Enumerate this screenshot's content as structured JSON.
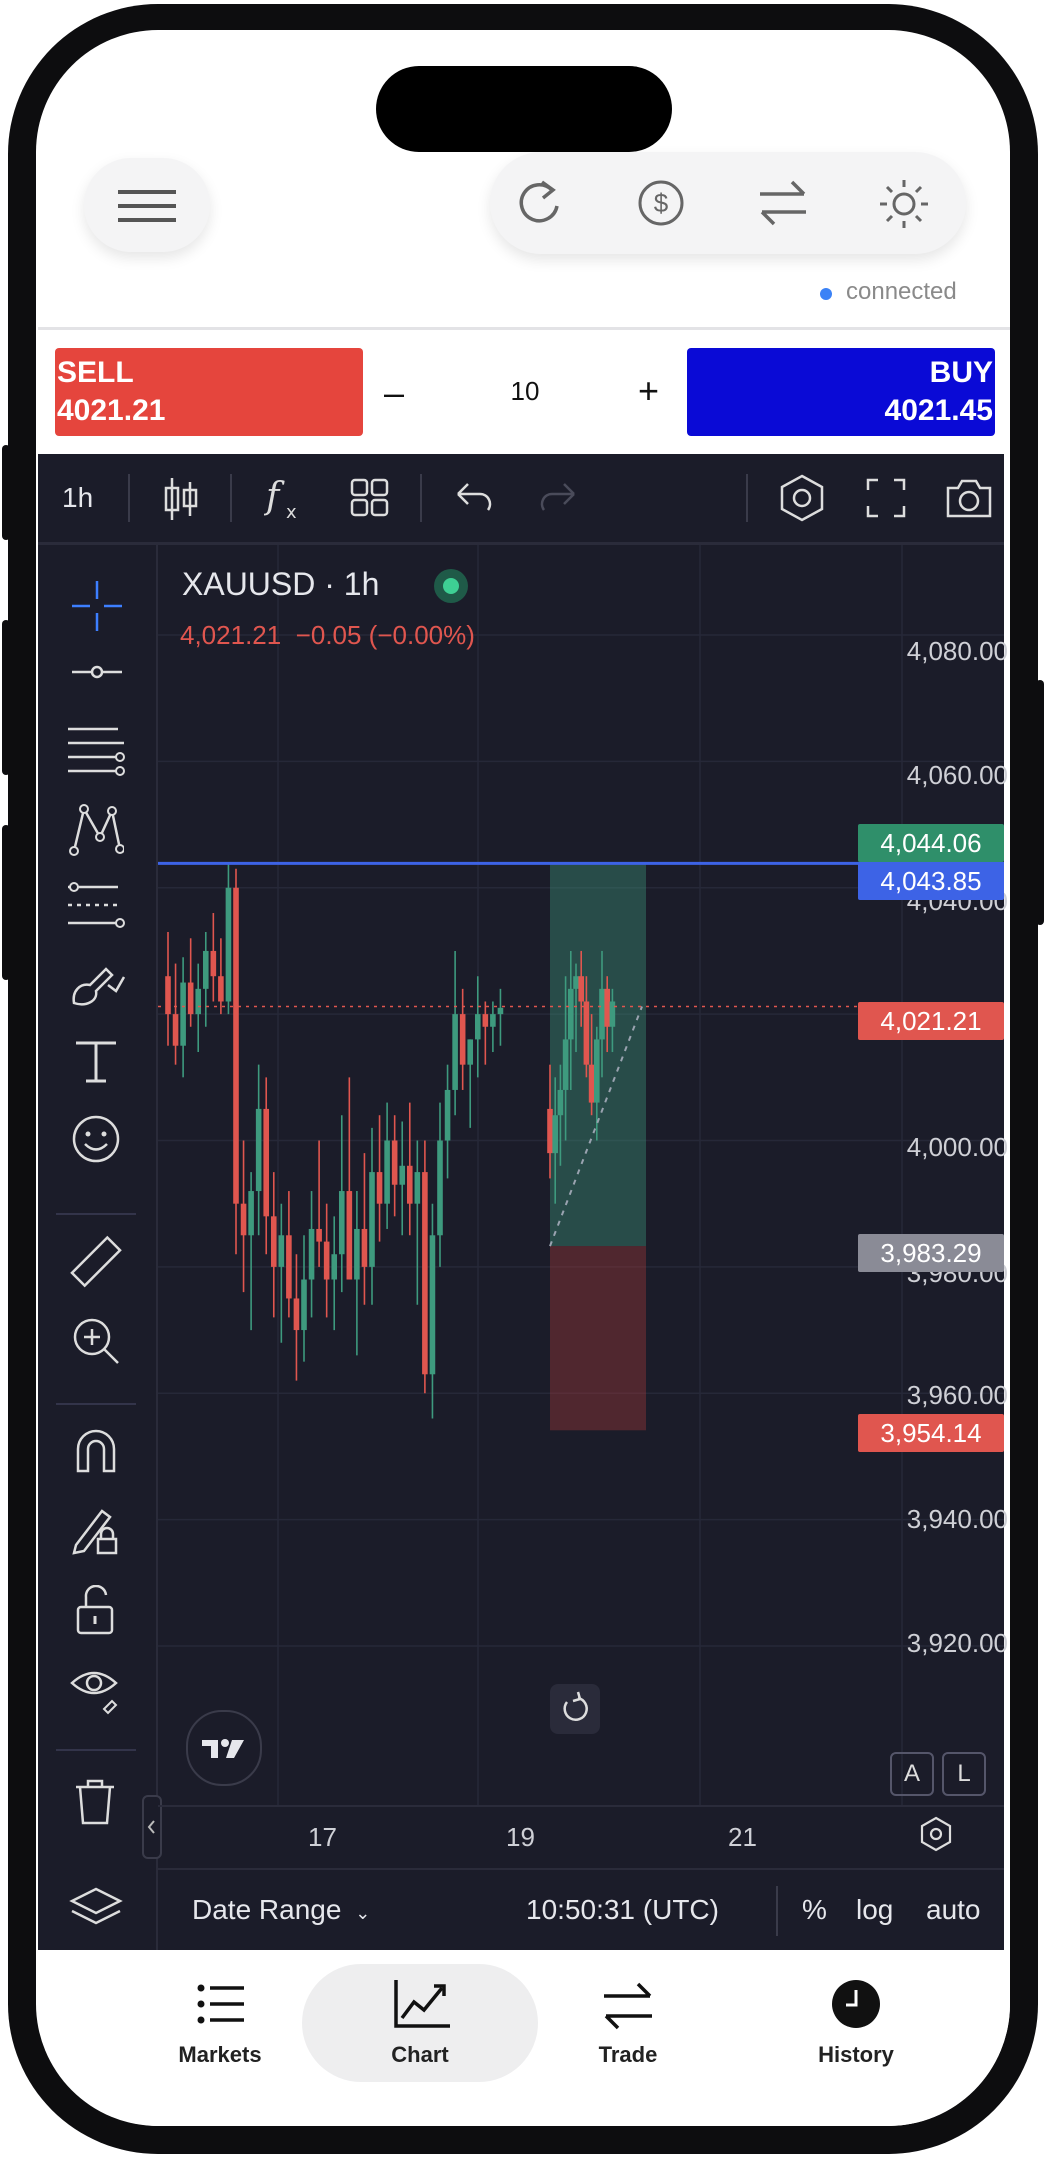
{
  "status": {
    "text": "connected",
    "color": "#3b82f6"
  },
  "trade": {
    "sell_label": "SELL",
    "sell_price": "4021.21",
    "buy_label": "BUY",
    "buy_price": "4021.45",
    "minus": "–",
    "plus": "+",
    "quantity": "10"
  },
  "header_icons": [
    "menu-icon",
    "refresh-icon",
    "dollar-coin-icon",
    "swap-arrows-icon",
    "sun-theme-icon"
  ],
  "toolbar": {
    "interval": "1h",
    "icons": [
      "candles-icon",
      "indicators-fx-icon",
      "layouts-grid-icon",
      "undo-icon",
      "redo-icon",
      "settings-hex-icon",
      "fullscreen-icon",
      "camera-snapshot-icon"
    ]
  },
  "drawing_tools": [
    "crosshair-icon",
    "trend-line-icon",
    "fib-lines-icon",
    "pattern-icon",
    "projection-icon",
    "brush-icon",
    "text-icon",
    "emoji-icon",
    "ruler-icon",
    "zoom-in-icon",
    "magnet-icon",
    "lock-drawing-icon",
    "unlock-icon",
    "eye-icon",
    "trash-icon",
    "layers-icon"
  ],
  "chart": {
    "symbol": "XAUUSD · 1h",
    "quote_price": "4,021.21",
    "quote_change": "−0.05 (−0.00%)",
    "price_axis": [
      "4,080.00",
      "4,060.00",
      "4,040.00",
      "4,000.00",
      "3,980.00",
      "3,960.00",
      "3,940.00",
      "3,920.00"
    ],
    "price_tags": {
      "tp": "4,044.06",
      "line": "4,043.85",
      "current": "4,021.21",
      "entry": "3,983.29",
      "sl": "3,954.14"
    },
    "time_axis": [
      "17",
      "19",
      "21"
    ],
    "scale_buttons": {
      "a": "A",
      "l": "L"
    },
    "colors": {
      "up": "#3e9a7e",
      "down": "#e0564f",
      "line": "#3d63e6",
      "bg": "#1b1c29"
    }
  },
  "bottom_bar": {
    "date_range": "Date Range",
    "time": "10:50:31 (UTC)",
    "pct": "%",
    "log": "log",
    "auto": "auto"
  },
  "nav": {
    "items": [
      {
        "label": "Markets",
        "icon": "list-icon"
      },
      {
        "label": "Chart",
        "icon": "line-chart-icon",
        "active": true
      },
      {
        "label": "Trade",
        "icon": "swap-arrows-icon"
      },
      {
        "label": "History",
        "icon": "clock-icon"
      }
    ]
  },
  "chart_data": {
    "type": "candlestick",
    "title": "XAUUSD · 1h",
    "x_ticks": [
      "17",
      "19",
      "21"
    ],
    "y_ticks": [
      3920,
      3940,
      3960,
      3980,
      4000,
      4040,
      4060,
      4080
    ],
    "ylim": [
      3910,
      4090
    ],
    "horizontal_line": 4043.85,
    "current_price": 4021.21,
    "position": {
      "take_profit": 4044.06,
      "entry": 3983.29,
      "stop_loss": 3954.14
    },
    "candles": [
      [
        4026,
        4033,
        4015,
        4020
      ],
      [
        4020,
        4028,
        4012,
        4015
      ],
      [
        4015,
        4029,
        4010,
        4025
      ],
      [
        4025,
        4032,
        4018,
        4020
      ],
      [
        4020,
        4028,
        4014,
        4024
      ],
      [
        4024,
        4033,
        4018,
        4030
      ],
      [
        4030,
        4036,
        4022,
        4026
      ],
      [
        4026,
        4032,
        4020,
        4022
      ],
      [
        4022,
        4044,
        4020,
        4040
      ],
      [
        4040,
        4043,
        3982,
        3990
      ],
      [
        3990,
        4000,
        3976,
        3985
      ],
      [
        3985,
        3995,
        3970,
        3992
      ],
      [
        3992,
        4012,
        3985,
        4005
      ],
      [
        4005,
        4010,
        3982,
        3988
      ],
      [
        3988,
        3995,
        3972,
        3980
      ],
      [
        3980,
        3990,
        3968,
        3985
      ],
      [
        3985,
        3992,
        3972,
        3975
      ],
      [
        3975,
        3982,
        3962,
        3970
      ],
      [
        3970,
        3985,
        3965,
        3978
      ],
      [
        3978,
        3992,
        3972,
        3986
      ],
      [
        3986,
        4000,
        3980,
        3984
      ],
      [
        3984,
        3990,
        3972,
        3978
      ],
      [
        3978,
        3988,
        3970,
        3982
      ],
      [
        3982,
        4004,
        3976,
        3992
      ],
      [
        3992,
        4010,
        3982,
        3978
      ],
      [
        3978,
        3992,
        3966,
        3986
      ],
      [
        3986,
        3998,
        3974,
        3980
      ],
      [
        3980,
        4002,
        3974,
        3995
      ],
      [
        3995,
        4004,
        3984,
        3990
      ],
      [
        3990,
        4006,
        3986,
        4000
      ],
      [
        4000,
        4004,
        3988,
        3993
      ],
      [
        3993,
        4003,
        3985,
        3996
      ],
      [
        3996,
        4006,
        3985,
        3990
      ],
      [
        3990,
        4000,
        3974,
        3995
      ],
      [
        3995,
        4000,
        3960,
        3963
      ],
      [
        3963,
        3990,
        3956,
        3985
      ],
      [
        3985,
        4006,
        3980,
        4000
      ],
      [
        4000,
        4012,
        3994,
        4008
      ],
      [
        4008,
        4030,
        4004,
        4020
      ],
      [
        4020,
        4024,
        4008,
        4012
      ],
      [
        4012,
        4016,
        4002,
        4016
      ],
      [
        4016,
        4026,
        4010,
        4020
      ],
      [
        4020,
        4022,
        4012,
        4018
      ],
      [
        4018,
        4022,
        4014,
        4020
      ],
      [
        4020,
        4024,
        4015,
        4021
      ],
      [
        4005,
        4012,
        3994,
        3998
      ],
      [
        3998,
        4010,
        3990,
        4004
      ],
      [
        4004,
        4012,
        3996,
        4008
      ],
      [
        4008,
        4026,
        4000,
        4016
      ],
      [
        4016,
        4030,
        4008,
        4024
      ],
      [
        4024,
        4028,
        4014,
        4026
      ],
      [
        4026,
        4030,
        4018,
        4022
      ],
      [
        4022,
        4026,
        4010,
        4012
      ],
      [
        4012,
        4020,
        4004,
        4006
      ],
      [
        4006,
        4018,
        4000,
        4016
      ],
      [
        4016,
        4030,
        4010,
        4024
      ],
      [
        4024,
        4026,
        4014,
        4018
      ],
      [
        4018,
        4024,
        4014,
        4022
      ]
    ]
  }
}
